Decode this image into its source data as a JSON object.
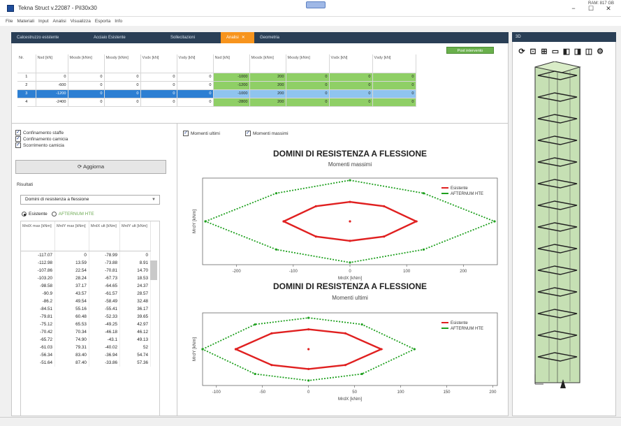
{
  "window": {
    "title": "Tekna Struct v.22087 - PiI30x30",
    "badge": "",
    "controls": [
      "−",
      "☐",
      "✕"
    ]
  },
  "menu": [
    "File",
    "Materiali",
    "Input",
    "Analisi",
    "Visualizza",
    "Esporta",
    "Info"
  ],
  "tabs": [
    {
      "label": "Calcestruzzo esistente"
    },
    {
      "label": "Acciaio Esistente"
    },
    {
      "label": "Sollecitazioni"
    },
    {
      "label": "Analisi",
      "active": true
    },
    {
      "label": "Geometria"
    }
  ],
  "grid": {
    "post_button": "Post intervento",
    "headers": [
      "Nr.",
      "Nsd [kN]",
      "Mxsdx [kNm]",
      "Mxsdy [kNm]",
      "Vsdx [kN]",
      "Vsdy [kN]",
      "Nsd [kN]",
      "Mxsdx [kNm]",
      "Mxsdy [kNm]",
      "Vsdx [kN]",
      "Vsdy [kN]"
    ],
    "rows": [
      [
        "1",
        "0",
        "0",
        "0",
        "0",
        "0",
        "-1000",
        "200",
        "0",
        "0",
        "0"
      ],
      [
        "2",
        "-600",
        "0",
        "0",
        "0",
        "0",
        "-1200",
        "200",
        "0",
        "0",
        "0"
      ],
      [
        "3",
        "-1200",
        "0",
        "0",
        "0",
        "0",
        "-1000",
        "200",
        "0",
        "0",
        "0"
      ],
      [
        "4",
        "-2400",
        "0",
        "0",
        "0",
        "0",
        "-2800",
        "200",
        "0",
        "0",
        "0"
      ]
    ],
    "selected_row": 2
  },
  "options": {
    "confinamento_staffe": "Confinamento staffe",
    "confinamento_camicia": "Confinamento camicia",
    "scorrimento_camicia": "Scorrimento camicia",
    "update_button": "Aggiorna",
    "risultati": "Risultati",
    "select_value": "Domini di resistenza a flessione",
    "radio_existing": "Esistente",
    "radio_after": "AFTERNUM HTE"
  },
  "results": {
    "headers": [
      "MrdX max [kNm]",
      "MrdY max [kNm]",
      "MrdX ult [kNm]",
      "MrdY ult [kNm]"
    ],
    "rows": [
      [
        "-117.07",
        "0",
        "-78.99",
        "0"
      ],
      [
        "-112.98",
        "13.59",
        "-73.88",
        "8.91"
      ],
      [
        "-107.86",
        "22.54",
        "-70.81",
        "14.70"
      ],
      [
        "-103.20",
        "28.24",
        "-67.73",
        "18.53"
      ],
      [
        "-98.58",
        "37.17",
        "-64.65",
        "24.37"
      ],
      [
        "-90.9",
        "43.57",
        "-61.57",
        "28.57"
      ],
      [
        "-86.2",
        "49.54",
        "-58.49",
        "32.48"
      ],
      [
        "-84.51",
        "55.16",
        "-55.41",
        "36.17"
      ],
      [
        "-79.81",
        "60.48",
        "-52.33",
        "39.65"
      ],
      [
        "-75.12",
        "65.53",
        "-49.25",
        "42.97"
      ],
      [
        "-70.42",
        "70.34",
        "-46.18",
        "46.12"
      ],
      [
        "-65.72",
        "74.90",
        "-43.1",
        "49.13"
      ],
      [
        "-61.03",
        "79.31",
        "-40.02",
        "52"
      ],
      [
        "-56.34",
        "83.40",
        "-36.94",
        "54.74"
      ],
      [
        "-51.64",
        "87.40",
        "-33.86",
        "57.36"
      ]
    ]
  },
  "charts": {
    "check_ultimi": "Momenti ultimi",
    "check_massimi": "Momenti massimi",
    "colors": {
      "existing": "#e02020",
      "after": "#1fa01f"
    }
  },
  "chart_data": [
    {
      "type": "line",
      "title": "DOMINI DI RESISTENZA A FLESSIONE",
      "subtitle": "Momenti massimi",
      "xlabel": "MrdX [kNm]",
      "ylabel": "MrdY [kNm]",
      "xlim": [
        -260,
        260
      ],
      "xticks": [
        -200,
        -100,
        0,
        100,
        200
      ],
      "series": [
        {
          "name": "Esistente",
          "x": [
            -117,
            -60,
            0,
            60,
            117,
            60,
            0,
            -60,
            -117
          ],
          "y": [
            0,
            70,
            90,
            70,
            0,
            -70,
            -90,
            -70,
            0
          ]
        },
        {
          "name": "AFTERNUM HTE",
          "x": [
            -255,
            -130,
            0,
            130,
            255,
            130,
            0,
            -130,
            -255
          ],
          "y": [
            0,
            130,
            190,
            130,
            0,
            -130,
            -190,
            -130,
            0
          ]
        }
      ]
    },
    {
      "type": "line",
      "title": "DOMINI DI RESISTENZA A FLESSIONE",
      "subtitle": "Momenti ultimi",
      "xlabel": "MrdX [kNm]",
      "ylabel": "MrdY [kNm]",
      "xlim": [
        -115,
        205
      ],
      "xticks": [
        -100,
        -50,
        0,
        50,
        100,
        150,
        200
      ],
      "series": [
        {
          "name": "Esistente",
          "x": [
            -79,
            -40,
            0,
            40,
            79,
            40,
            0,
            -40,
            -79
          ],
          "y": [
            0,
            48,
            60,
            48,
            0,
            -48,
            -60,
            -48,
            0
          ]
        },
        {
          "name": "AFTERNUM HTE",
          "x": [
            -115,
            -58,
            0,
            58,
            115,
            58,
            0,
            -58,
            -115
          ],
          "y": [
            0,
            75,
            95,
            75,
            0,
            -75,
            -95,
            -75,
            0
          ]
        }
      ]
    }
  ],
  "right_panel": {
    "title": "3D",
    "tools": [
      "refresh-icon",
      "fit-icon",
      "grid-icon",
      "view-front-icon",
      "view-side-icon",
      "view-iso-icon",
      "box-icon",
      "settings-icon"
    ]
  },
  "status": {
    "text": "RAM: 817 GB"
  }
}
